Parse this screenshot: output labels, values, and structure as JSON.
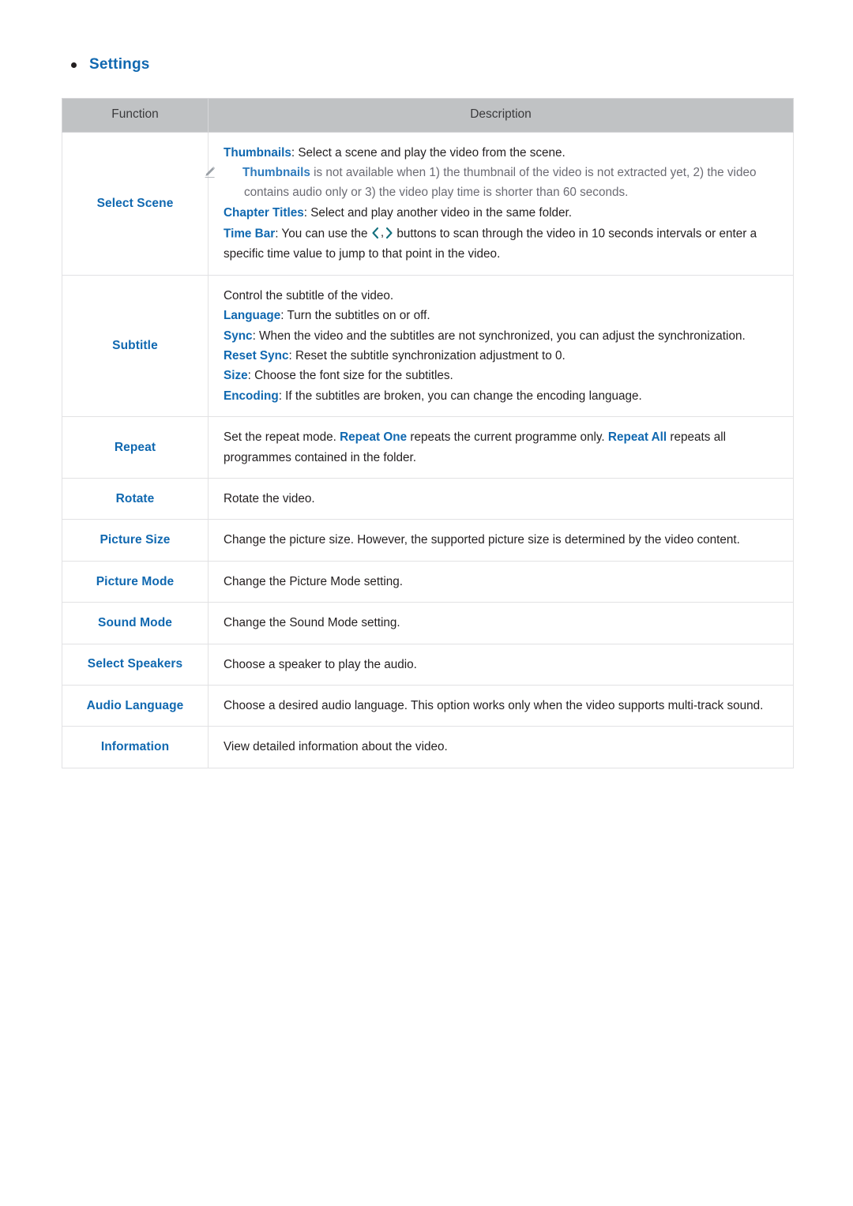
{
  "heading": {
    "bullet_icon": "bullet-dot-icon",
    "title": "Settings"
  },
  "colors": {
    "accent_blue": "#1068b0",
    "note_gray": "#6b6b73",
    "header_bg": "#c0c2c4",
    "chevron_teal": "#14707e",
    "border": "#e2e2e4"
  },
  "table": {
    "columns": [
      {
        "label": "Function"
      },
      {
        "label": "Description"
      }
    ],
    "rows": [
      {
        "function": "Select Scene",
        "lines": [
          {
            "type": "normal",
            "kw": "Thumbnails",
            "sep": ": ",
            "text": "Select a scene and play the video from the scene."
          },
          {
            "type": "note",
            "icon": "pencil-icon",
            "kw": "Thumbnails",
            "sep": " ",
            "text": "is not available when 1) the thumbnail of the video is not extracted yet, 2) the video contains audio only or 3) the video play time is shorter than 60 seconds."
          },
          {
            "type": "normal",
            "kw": "Chapter Titles",
            "sep": ": ",
            "text": "Select and play another video in the same folder."
          },
          {
            "type": "timebar",
            "kw": "Time Bar",
            "sep": ": ",
            "text_before": "You can use the ",
            "arrow_left": "chevron-left-icon",
            "arrow_comma": ",",
            "arrow_right": "chevron-right-icon",
            "text_after": " buttons to scan through the video in 10 seconds intervals or enter a specific time value to jump to that point in the video."
          }
        ]
      },
      {
        "function": "Subtitle",
        "lines": [
          {
            "type": "plain",
            "text": "Control the subtitle of the video."
          },
          {
            "type": "normal",
            "kw": "Language",
            "sep": ": ",
            "text": "Turn the subtitles on or off."
          },
          {
            "type": "normal",
            "kw": "Sync",
            "sep": ": ",
            "text": "When the video and the subtitles are not synchronized, you can adjust the synchronization."
          },
          {
            "type": "normal",
            "kw": "Reset Sync",
            "sep": ": ",
            "text": "Reset the subtitle synchronization adjustment to 0."
          },
          {
            "type": "normal",
            "kw": "Size",
            "sep": ": ",
            "text": "Choose the font size for the subtitles."
          },
          {
            "type": "normal",
            "kw": "Encoding",
            "sep": ": ",
            "text": "If the subtitles are broken, you can change the encoding language."
          }
        ]
      },
      {
        "function": "Repeat",
        "lines": [
          {
            "type": "repeat",
            "t1": "Set the repeat mode. ",
            "kw1": "Repeat One",
            "t2": " repeats the current programme only. ",
            "kw2": "Repeat All",
            "t3": " repeats all programmes contained in the folder."
          }
        ]
      },
      {
        "function": "Rotate",
        "lines": [
          {
            "type": "plain",
            "text": "Rotate the video."
          }
        ]
      },
      {
        "function": "Picture Size",
        "lines": [
          {
            "type": "plain",
            "text": "Change the picture size. However, the supported picture size is determined by the video content."
          }
        ]
      },
      {
        "function": "Picture Mode",
        "lines": [
          {
            "type": "plain",
            "text": "Change the Picture Mode setting."
          }
        ]
      },
      {
        "function": "Sound Mode",
        "lines": [
          {
            "type": "plain",
            "text": "Change the Sound Mode setting."
          }
        ]
      },
      {
        "function": "Select Speakers",
        "lines": [
          {
            "type": "plain",
            "text": "Choose a speaker to play the audio."
          }
        ]
      },
      {
        "function": "Audio Language",
        "lines": [
          {
            "type": "plain",
            "text": "Choose a desired audio language. This option works only when the video supports multi-track sound."
          }
        ]
      },
      {
        "function": "Information",
        "lines": [
          {
            "type": "plain",
            "text": "View detailed information about the video."
          }
        ]
      }
    ]
  }
}
